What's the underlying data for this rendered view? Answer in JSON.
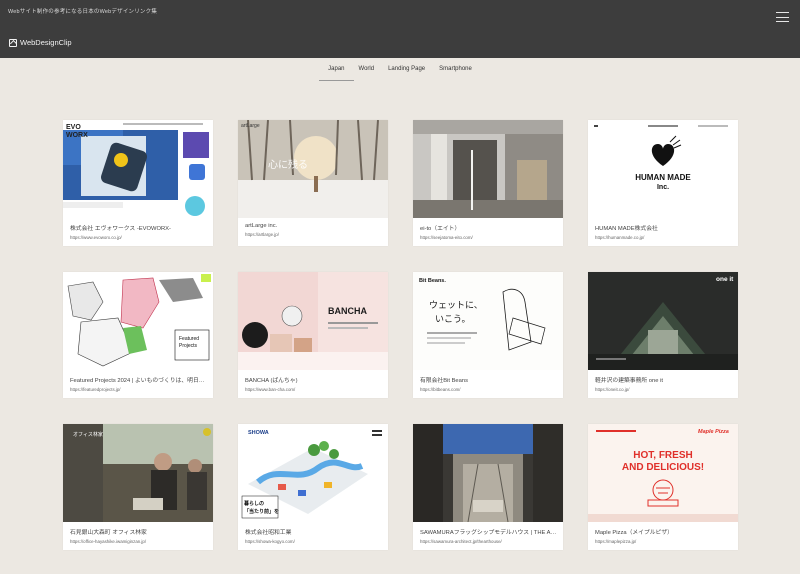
{
  "header": {
    "tagline": "Webサイト制作の参考になる日本のWebデザインリンク集",
    "logo_text": "WebDesignClip"
  },
  "tabs": [
    {
      "label": "Japan",
      "active": true
    },
    {
      "label": "World",
      "active": false
    },
    {
      "label": "Landing Page",
      "active": false
    },
    {
      "label": "Smartphone",
      "active": false
    }
  ],
  "cards": [
    {
      "title": "株式会社 エヴォワークス -EVOWORX-",
      "url": "https://www.evoworx.co.jp/",
      "thumb_text": "EVO WORX"
    },
    {
      "title": "artLarge inc.",
      "url": "https://artlarge.jp/",
      "thumb_text": "artLarge"
    },
    {
      "title": "ei-to（エイト）",
      "url": "https://seejatoma-eito.com/",
      "thumb_text": ""
    },
    {
      "title": "HUMAN MADE株式会社",
      "url": "https://humanmade.co.jp/",
      "thumb_text": "HUMAN MADE Inc."
    },
    {
      "title": "Featured Projects 2024 | よいものづくりは、明日…",
      "url": "https://featuredprojects.jp/",
      "thumb_text": "Featured Projects"
    },
    {
      "title": "BANCHA (ばんちゃ)",
      "url": "https://www.ban-cha.com/",
      "thumb_text": "BANCHA"
    },
    {
      "title": "有限会社Bit Beans",
      "url": "https://bitbeans.com/",
      "thumb_text": "Bit Beans."
    },
    {
      "title": "軽井沢の建築事務所 one it",
      "url": "https://oneit.co.jp/",
      "thumb_text": "one it"
    },
    {
      "title": "石見銀山大森町 オフィス林家",
      "url": "https://office-hayashike.iwamiginzan.jp/",
      "thumb_text": ""
    },
    {
      "title": "株式会社昭和工業",
      "url": "https://showa-kogyo.com/",
      "thumb_text": "SHOWA"
    },
    {
      "title": "SAWAMURAフラッグシップモデルハウス | THE A…",
      "url": "https://sawamura-architect.jp/thearthouse/",
      "thumb_text": ""
    },
    {
      "title": "Maple Pizza（メイプルピザ）",
      "url": "https://maplepizza.jp/",
      "thumb_text": "HOT, FRESH AND DELICIOUS!"
    }
  ],
  "colors": {
    "header_bg": "#3d3d3d",
    "page_bg": "#ece8e2",
    "card_bg": "#ffffff"
  }
}
